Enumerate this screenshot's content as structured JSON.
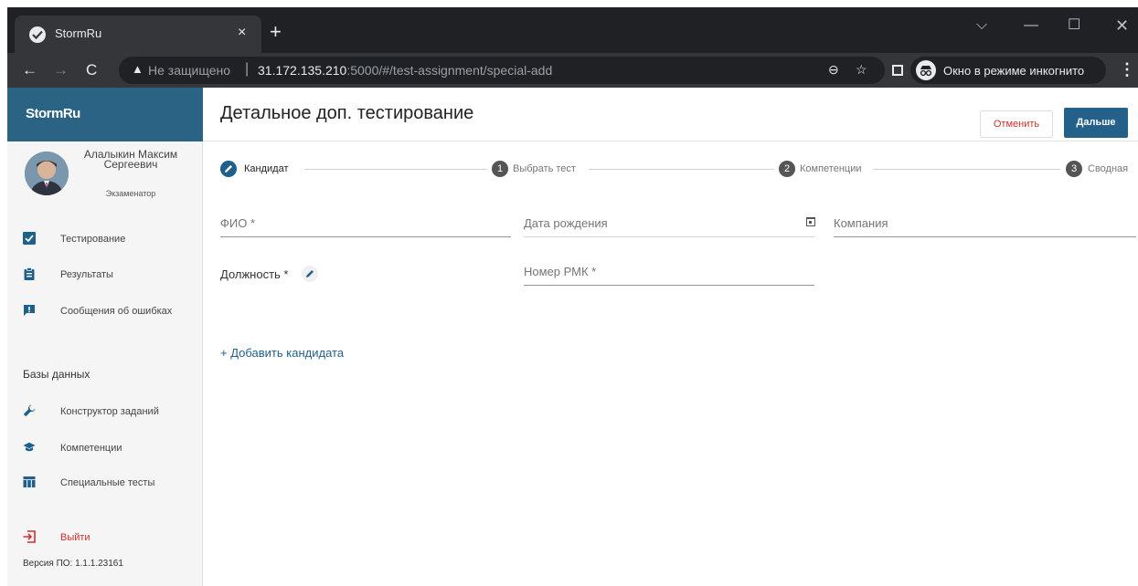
{
  "browser": {
    "tab_title": "StormRu",
    "tab_close": "×",
    "new_tab": "+",
    "insecure_label": "Не защищено",
    "separator": "|",
    "url_host": "31.172.135.210",
    "url_path": ":5000/#/test-assignment/special-add",
    "incognito_label": "Окно в режиме инкогнито"
  },
  "sidebar": {
    "brand": "StormRu",
    "user": {
      "name": "Алалыкин Максим Сергеевич",
      "role": "Экзаменатор"
    },
    "items": [
      {
        "label": "Тестирование",
        "icon": "checkbox-icon"
      },
      {
        "label": "Результаты",
        "icon": "clipboard-icon"
      },
      {
        "label": "Сообщения об ошибках",
        "icon": "report-icon"
      }
    ],
    "section_title": "Базы данных",
    "db_items": [
      {
        "label": "Конструктор заданий",
        "icon": "wrench-icon"
      },
      {
        "label": "Компетенции",
        "icon": "school-icon"
      },
      {
        "label": "Специальные тесты",
        "icon": "table-icon"
      }
    ],
    "logout": "Выйти",
    "version": "Версия ПО: 1.1.1.23161"
  },
  "header": {
    "title": "Детальное доп. тестирование",
    "cancel": "Отменить",
    "next": "Дальше"
  },
  "stepper": [
    {
      "num": "",
      "label": "Кандидат",
      "active": true
    },
    {
      "num": "1",
      "label": "Выбрать тест",
      "active": false
    },
    {
      "num": "2",
      "label": "Компетенции",
      "active": false
    },
    {
      "num": "3",
      "label": "Сводная",
      "active": false
    }
  ],
  "form": {
    "fio_label": "ФИО *",
    "birth_label": "Дата рождения",
    "company_label": "Компания",
    "position_label": "Должность *",
    "rmk_label": "Номер РМК *",
    "add_candidate": "+ Добавить кандидата"
  },
  "colors": {
    "brand": "#2a6384",
    "accent": "#24618a",
    "danger": "#d32f2f",
    "browser_dark": "#202124"
  }
}
